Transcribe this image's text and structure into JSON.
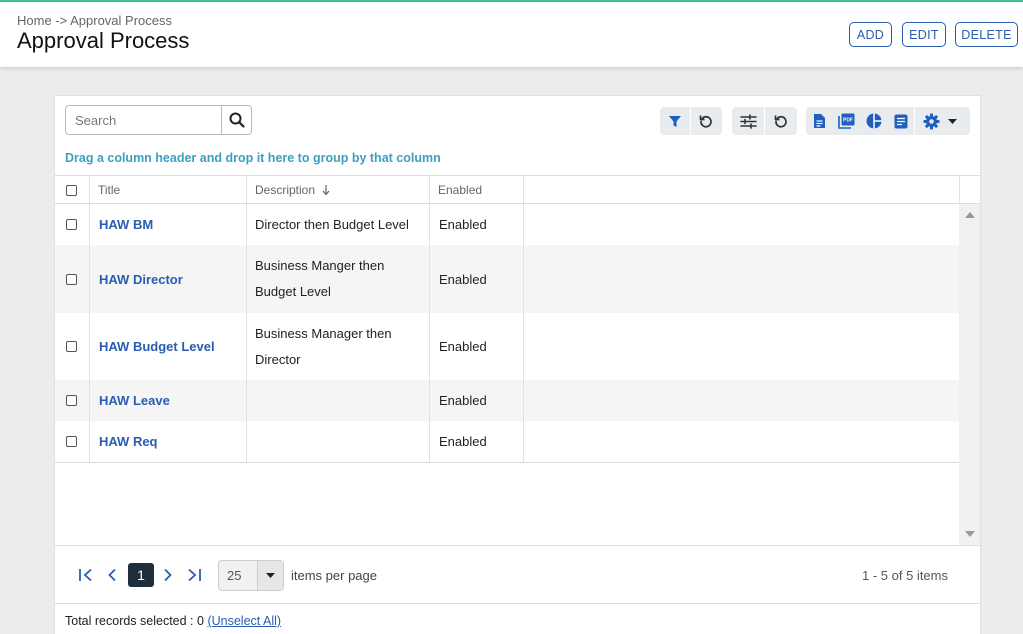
{
  "header": {
    "breadcrumb": "Home -> Approval Process",
    "title": "Approval Process",
    "buttons": {
      "add": "ADD",
      "edit": "EDIT",
      "delete": "DELETE"
    }
  },
  "toolbar": {
    "search_placeholder": "Search",
    "icons": [
      "filter-icon",
      "reset-filter-icon",
      "column-settings-icon",
      "reset-columns-icon",
      "excel-export-icon",
      "pdf-export-icon",
      "chart-icon",
      "report-icon",
      "settings-icon"
    ]
  },
  "group_hint": "Drag a column header and drop it here to group by that column",
  "grid": {
    "columns": {
      "title": "Title",
      "description": "Description",
      "enabled": "Enabled"
    },
    "sort": {
      "column": "Description",
      "direction": "descending"
    },
    "rows": [
      {
        "title": "HAW BM",
        "description": "Director then Budget Level",
        "enabled": "Enabled"
      },
      {
        "title": "HAW Director",
        "description": "Business Manger then Budget Level",
        "enabled": "Enabled"
      },
      {
        "title": "HAW Budget Level",
        "description": "Business Manager then Director",
        "enabled": "Enabled"
      },
      {
        "title": "HAW Leave",
        "description": "",
        "enabled": "Enabled"
      },
      {
        "title": "HAW Req",
        "description": "",
        "enabled": "Enabled"
      }
    ]
  },
  "pager": {
    "current_page": "1",
    "page_size": "25",
    "items_per_page_label": "items per page",
    "info": "1 - 5 of 5 items"
  },
  "footer": {
    "total_label": "Total records selected : 0",
    "unselect_label": "(Unselect All)"
  },
  "colors": {
    "accent": "#2a5db0",
    "hint": "#3d9fc2",
    "toolbar_icon": "#1f5fbf",
    "top_line": "#3dbf9a"
  }
}
